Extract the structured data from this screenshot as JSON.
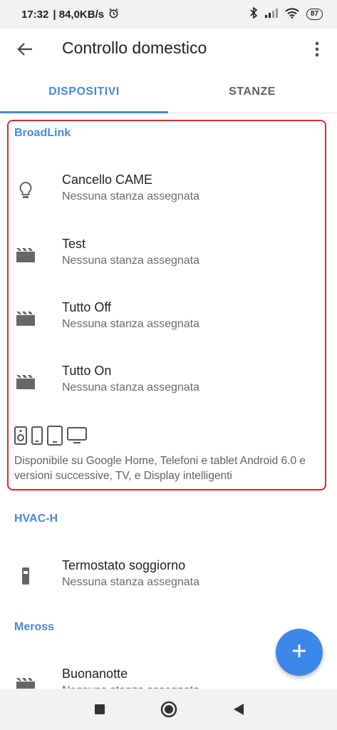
{
  "status_bar": {
    "time": "17:32",
    "net_speed": "| 84,0KB/s",
    "battery": "87",
    "icons": [
      "alarm-icon",
      "bluetooth-icon",
      "signal-icon",
      "wifi-icon",
      "battery-icon"
    ]
  },
  "app_bar": {
    "title": "Controllo domestico",
    "back_icon": "arrow-back-icon",
    "menu_icon": "more-vert-icon"
  },
  "tabs": [
    {
      "label": "DISPOSITIVI",
      "active": true
    },
    {
      "label": "STANZE",
      "active": false
    }
  ],
  "sections": [
    {
      "header": "BroadLink",
      "devices": [
        {
          "name": "Cancello CAME",
          "subtitle": "Nessuna stanza assegnata",
          "icon": "lightbulb-icon"
        },
        {
          "name": "Test",
          "subtitle": "Nessuna stanza assegnata",
          "icon": "scene-icon"
        },
        {
          "name": "Tutto Off",
          "subtitle": "Nessuna stanza assegnata",
          "icon": "scene-icon"
        },
        {
          "name": "Tutto On",
          "subtitle": "Nessuna stanza assegnata",
          "icon": "scene-icon"
        }
      ],
      "availability_icons": [
        "speaker-icon",
        "phone-icon",
        "tablet-icon",
        "tv-icon"
      ],
      "availability_text": "Disponibile su Google Home, Telefoni e tablet Android 6.0 e versioni successive, TV, e Display intelligenti"
    },
    {
      "header": "HVAC-H",
      "devices": [
        {
          "name": "Termostato soggiorno",
          "subtitle": "Nessuna stanza assegnata",
          "icon": "thermostat-icon"
        }
      ]
    },
    {
      "header": "Meross",
      "devices": [
        {
          "name": "Buonanotte",
          "subtitle": "Nessuna stanza assegnata",
          "icon": "scene-icon"
        }
      ]
    }
  ],
  "fab": {
    "icon": "add-icon"
  },
  "nav_bar": {
    "icons": [
      "recents-square-icon",
      "home-circle-icon",
      "back-triangle-icon"
    ]
  },
  "colors": {
    "accent": "#4a88da",
    "fab": "#3d86ea",
    "highlight": "#d62b2b"
  }
}
